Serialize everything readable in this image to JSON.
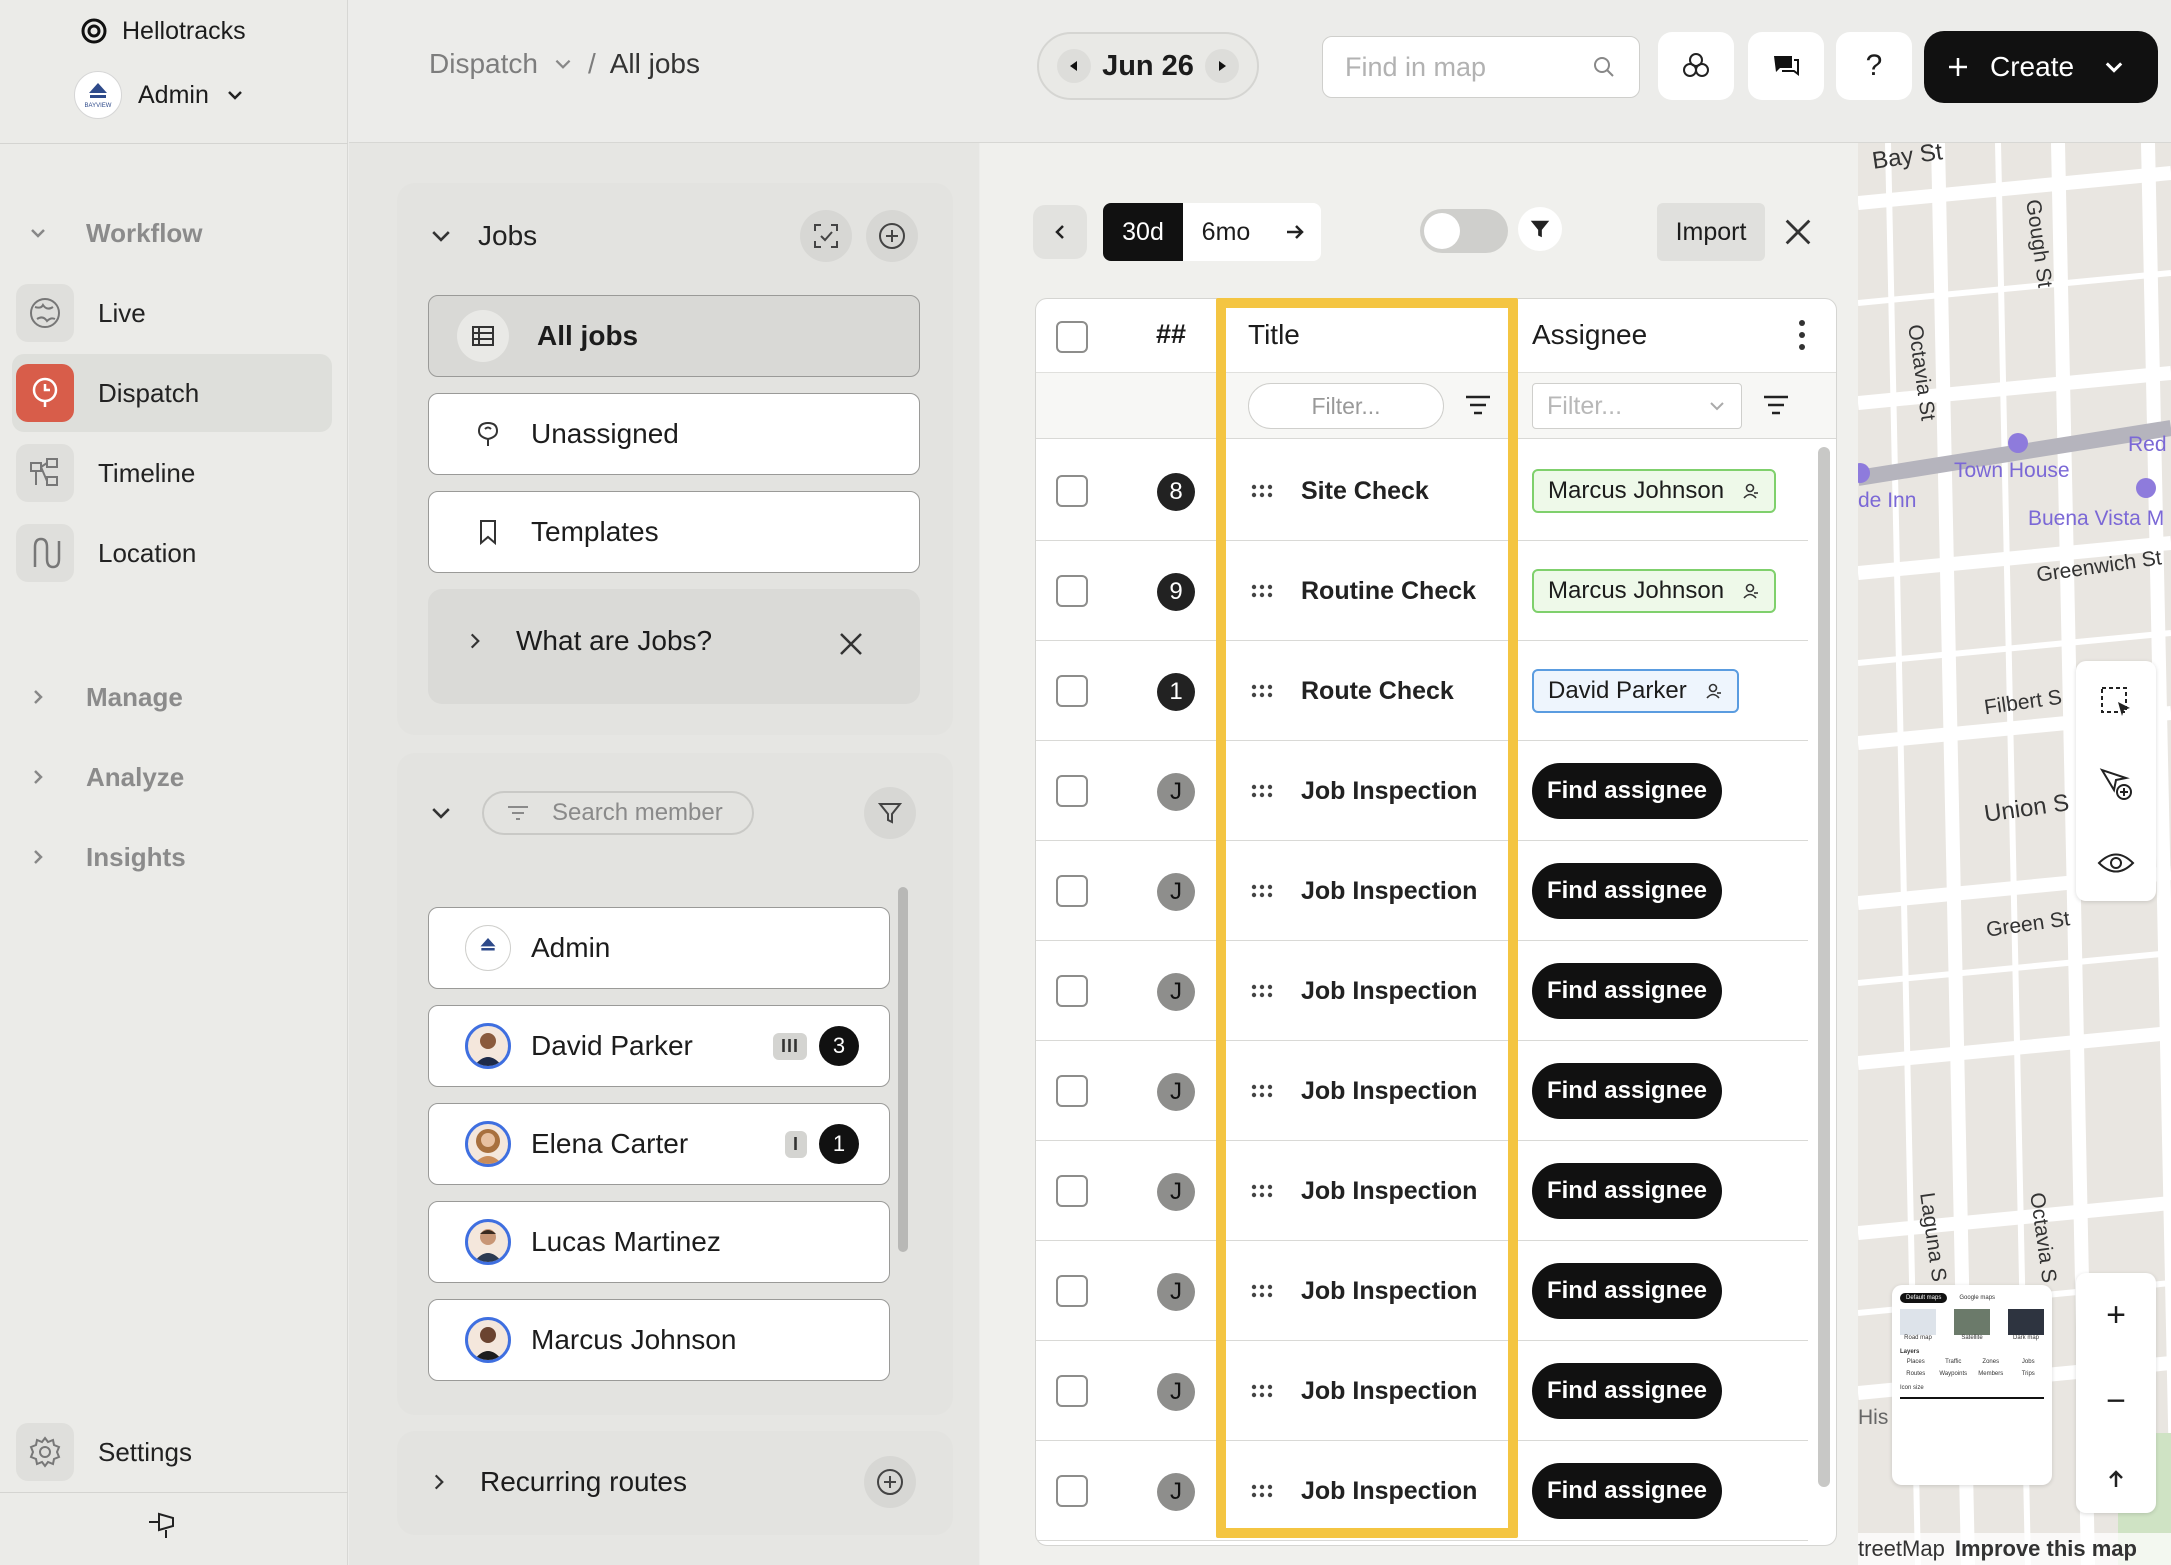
{
  "sidebar": {
    "brand": "Hellotracks",
    "account": "Admin",
    "logo_text": "BAYVIEW",
    "groups": {
      "workflow": "Workflow",
      "manage": "Manage",
      "analyze": "Analyze",
      "insights": "Insights"
    },
    "items": [
      {
        "label": "Live",
        "icon": "globe-icon"
      },
      {
        "label": "Dispatch",
        "icon": "dispatch-icon",
        "active": true
      },
      {
        "label": "Timeline",
        "icon": "timeline-icon"
      },
      {
        "label": "Location",
        "icon": "location-route-icon"
      }
    ],
    "settings": "Settings"
  },
  "header": {
    "breadcrumb_parent": "Dispatch",
    "breadcrumb_current": "All jobs",
    "date": "Jun 26",
    "map_search_placeholder": "Find in map",
    "help": "?",
    "create_label": "Create"
  },
  "jobs_panel": {
    "title": "Jobs",
    "views": [
      {
        "label": "All jobs",
        "icon": "table-icon",
        "active": true
      },
      {
        "label": "Unassigned",
        "icon": "unassigned-pin-icon"
      },
      {
        "label": "Templates",
        "icon": "bookmark-icon"
      }
    ],
    "help_card": "What are Jobs?"
  },
  "members_panel": {
    "search_placeholder": "Search member",
    "members": [
      {
        "name": "Admin",
        "avatar": "bayview-logo"
      },
      {
        "name": "David Parker",
        "bars": "III",
        "count": "3"
      },
      {
        "name": "Elena Carter",
        "bars": "I",
        "count": "1"
      },
      {
        "name": "Lucas Martinez"
      },
      {
        "name": "Marcus Johnson"
      }
    ]
  },
  "routes_panel": {
    "title": "Recurring routes"
  },
  "toolbar": {
    "range_30d": "30d",
    "range_6mo": "6mo",
    "import": "Import"
  },
  "table": {
    "col_num": "##",
    "col_title": "Title",
    "col_assignee": "Assignee",
    "filter_placeholder": "Filter...",
    "assignee_filter_placeholder": "Filter...",
    "rows": [
      {
        "num": "8",
        "title": "Site Check",
        "assignee": "Marcus Johnson",
        "chip": "green"
      },
      {
        "num": "9",
        "title": "Routine Check",
        "assignee": "Marcus Johnson",
        "chip": "green"
      },
      {
        "num": "1",
        "title": "Route Check",
        "assignee": "David Parker",
        "chip": "blue"
      },
      {
        "num": "J",
        "title": "Job Inspection",
        "assignee": "Find assignee"
      },
      {
        "num": "J",
        "title": "Job Inspection",
        "assignee": "Find assignee"
      },
      {
        "num": "J",
        "title": "Job Inspection",
        "assignee": "Find assignee"
      },
      {
        "num": "J",
        "title": "Job Inspection",
        "assignee": "Find assignee"
      },
      {
        "num": "J",
        "title": "Job Inspection",
        "assignee": "Find assignee"
      },
      {
        "num": "J",
        "title": "Job Inspection",
        "assignee": "Find assignee"
      },
      {
        "num": "J",
        "title": "Job Inspection",
        "assignee": "Find assignee"
      },
      {
        "num": "J",
        "title": "Job Inspection",
        "assignee": "Find assignee"
      }
    ]
  },
  "map": {
    "streets": [
      "Bay St",
      "Gough St",
      "Octavia St",
      "Greenwich St",
      "Filbert S",
      "Union S",
      "Green St",
      "Laguna S",
      "Octavia S"
    ],
    "places": [
      "Town House",
      "Red",
      "de Inn",
      "Buena Vista M"
    ],
    "left_edge_label": "His",
    "attribution": "treetMap",
    "improve": "Improve this map",
    "zoom_in": "+",
    "zoom_out": "−",
    "layer_thumb": {
      "tab_default": "Default maps",
      "tab_google": "Google maps",
      "types": [
        "Road map",
        "Satellite",
        "Dark map"
      ],
      "layers_title": "Layers",
      "layers": [
        "Places",
        "Traffic",
        "Zones",
        "Jobs",
        "Routes",
        "Waypoints",
        "Members",
        "Trips"
      ],
      "icon_size": "Icon size"
    }
  },
  "colors": {
    "accent_dispatch": "#d85d4a",
    "highlight": "#f4c542",
    "chip_green": "#7fd06c",
    "chip_blue": "#5a9ce0"
  }
}
